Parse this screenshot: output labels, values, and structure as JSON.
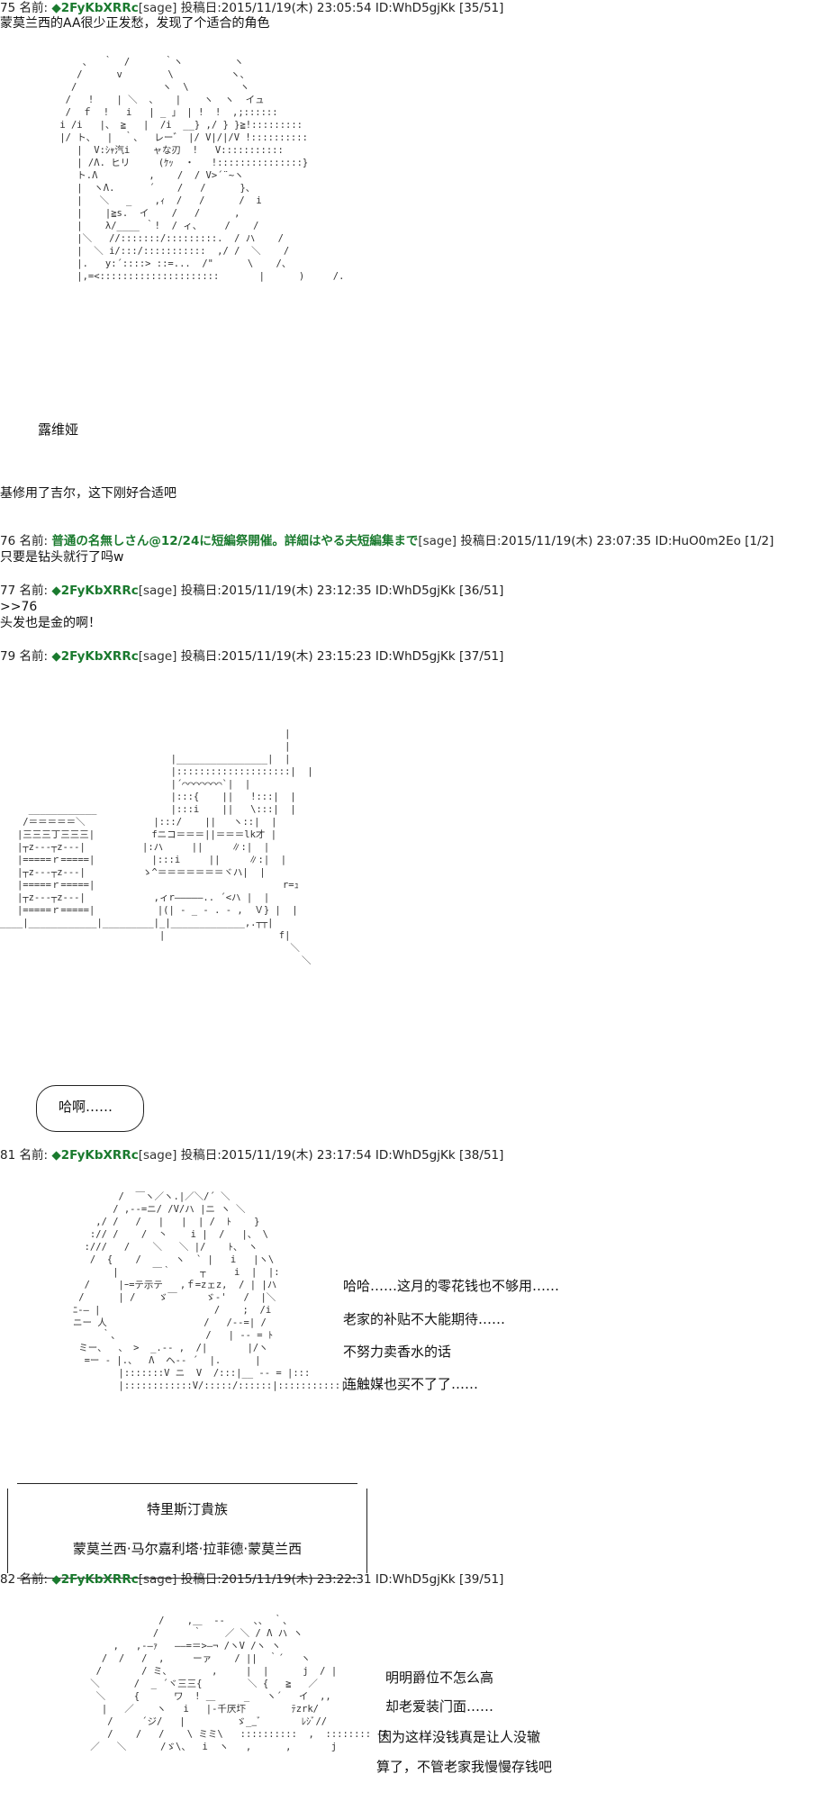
{
  "posts": [
    {
      "num": "75",
      "label": "名前:",
      "name": "◆2FyKbXRRc",
      "sage": "[sage]",
      "meta": "投稿日:2015/11/19(木) 23:05:54 ID:WhD5gjKk [35/51]"
    },
    {
      "num": "76",
      "label": "名前:",
      "name": "普通の名無しさん@12/24に短編祭開催。詳細はやる夫短編集まで",
      "sage": "[sage]",
      "meta": "投稿日:2015/11/19(木) 23:07:35 ID:HuO0m2Eo [1/2]"
    },
    {
      "num": "77",
      "label": "名前:",
      "name": "◆2FyKbXRRc",
      "sage": "[sage]",
      "meta": "投稿日:2015/11/19(木) 23:12:35 ID:WhD5gjKk [36/51]"
    },
    {
      "num": "79",
      "label": "名前:",
      "name": "◆2FyKbXRRc",
      "sage": "[sage]",
      "meta": "投稿日:2015/11/19(木) 23:15:23 ID:WhD5gjKk [37/51]"
    },
    {
      "num": "81",
      "label": "名前:",
      "name": "◆2FyKbXRRc",
      "sage": "[sage]",
      "meta": "投稿日:2015/11/19(木) 23:17:54 ID:WhD5gjKk [38/51]"
    },
    {
      "num": "82",
      "label": "名前:",
      "name": "◆2FyKbXRRc",
      "sage": "[sage]",
      "meta": "投稿日:2015/11/19(木) 23:22:31 ID:WhD5gjKk [39/51]"
    }
  ],
  "texts": {
    "p75_line": "蒙莫兰西的AA很少正发愁，发现了个适合的角色",
    "p75_caption": "露维娅",
    "p75_footer": "基修用了吉尔，这下刚好合适吧",
    "p76_line": "只要是钻头就行了吗w",
    "p77_quote": ">>76",
    "p77_line": "头发也是金的啊！",
    "p79_bubble": "哈啊……",
    "p81_dialog": [
      "哈哈……这月的零花钱也不够用……",
      "老家的补贴不大能期待……",
      "不努力卖香水的话",
      "连触媒也买不了了……"
    ],
    "p81_box": [
      "特里斯汀貴族",
      "蒙莫兰西·马尔嘉利塔·拉菲德·蒙莫兰西"
    ],
    "p82_dialog": [
      "明明爵位不怎么高",
      "却老爱装门面……",
      "因为这样没钱真是让人没辙",
      "算了，不管老家我慢慢存钱吧"
    ]
  },
  "aa": {
    "ruvia": "     、  ｀  /      ｀ヽ         ヽ\n    /      v        \\          ヽ、\n   /               ヽ  \\         ヽ\n  /   !    | ＼  、   |    ヽ  ヽ  イュ\n  /  ｆ  !   i   | _ 」 | !  !  ,;::::::\n i /i   |、 ≧   |  /i  __} ,/ } }≧!:::::::::\n |/ ト、  |  ｀、  レー゛ |/ V|/|/V !::::::::::\n    |  V:ｼｬ汽i    ャな刃  !   V:::::::::::\n    | /Λ. ヒリ     (ｹｯ  ・   !:::::::::::::::}\n    ト.Λ         ,    /  / V>´¨~ヽ\n    |  ヽΛ.      ´    /   /      }、\n    |   ＼   _    ,ｨ  /   /      /  i\n    |    |≧s.  イ    /   /      ,\n    |    λ/____ ｀!  / ィ、    /    /\n    |＼   //:::::::/:::::::::.  / ハ    /\n    |  ＼ i/:::/:::::::::::  ,/ /  ＼    /\n    |.   y:´::::> ::=...  /\"      \\    /、\n    |,=<:::::::::::::::::::::       |      )     /.",
    "room": "                                                  |\n                                                  |\n                              |________________|  |\n                              |::::::::::::::::::::|  |\n                              |´⌒⌒⌒⌒⌒⌒⌒`|  |\n                              |:::{    ||   !:::|  |\n     ____________             |:::i    ||   \\:::|  |\n    /＝＝＝＝＝＼            |:::/    ||   ヽ::|  |\n   |三三三丁三三三|          fニコ＝＝＝||＝＝＝lk才 |\n   |┬z-‐‐┬z-‐‐|          |:ハ     ||     ∥:|  |\n   |=====ｒ=====|          |:::i     ||     ∥:|  |\n   |┬z-‐‐┬z-‐‐|          ゝ^＝＝＝＝＝＝＝ヾハ|  |\n   |=====ｒ=====|                                 r=ｭ\n   |┬z-‐‐┬z-‐‐|            ,ィr―――――.. ´<ハ |  |\n   |=====ｒ=====|           |(| ‐ _ ‐ . ‐ ,  Ｖ} |  |\n____|____________|_________|_|_____________,.┬┬|\n                            |                    f|\n                                                   ＼\n                                                     ＼",
    "montmo": "           /  ￣ヽ／ヽ.|／＼/´ ＼\n          / ,-‐=ニ/ /V/ハ |ニ ヽ ＼\n       ,/ /   /   |   |  | /  ﾄ    }\n      :// /    /  丶    i |  /   |、 \\\n     :///   /    ＼   ＼ |/    ﾄ、 ヽ\n      /  {    /      ヽ  ` |   i   |ヽ\\\n          |      ￣｀     ┬     i  |  |:\n     /     |ｰ=テ示テ   ,ｆ=zェz,  / | |ハ\n    /      | /    ゞ￣     ゞ‐'   /  |＼\n   ﾆ-― |                    /    ;  /i\n   ニー 人                 /   /--=| /\n        ｀、               /   | -- = ﾄ\n    ミー、  、 >  _.-- ,  /|       |/ヽ\n     =ー - |.、  Λ  ヘ-‐ ´  |.      |\n           |:::::::V ニ  V  /:::|__ -- = |:::\n           |::::::::::::V/:::::/::::::|:::::::::::|::::",
    "montmo2": "                /    ,＿  -‐     、、 ｀、\n               /      ｀    ／ ＼ / Λ ハ ヽ\n        ,   ,-―ｧ   ――=＝>―¬ /ヽV /ヽ ヽ\n      /  /   /  ,     ーァ    / ||  ｀´   ヽ\n     /       / ミ、       ,     |  |      j  / |\n    ＼      /  _ ´ヾ三三{        ＼ {   ≧   ／\n     ＼     {      ワ  ! ＿     _   ヽ´   イ  ,,\n      |   ／    ヽ   i   |-千厌圷        ﾃzrk/\n       /     ´ジ/   |         ゞ__ﾞ       ﾚｼﾞ//\n       /    /   /    \\ ミミ\\   ::::::::::  ,  :::::::: {Λ\n    ／   ＼      /ゞ\\、  i  ヽ   ,      ,       j"
  }
}
